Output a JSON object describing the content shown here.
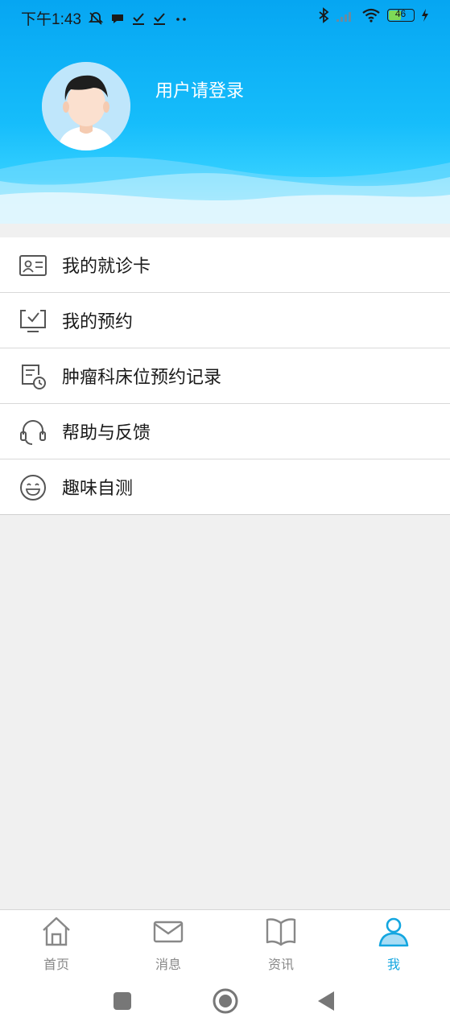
{
  "status_bar": {
    "time": "下午1:43",
    "battery": "46"
  },
  "profile": {
    "login_prompt": "用户请登录"
  },
  "menu": [
    {
      "label": "我的就诊卡",
      "icon": "id-card-icon"
    },
    {
      "label": "我的预约",
      "icon": "monitor-check-icon"
    },
    {
      "label": "肿瘤科床位预约记录",
      "icon": "document-clock-icon"
    },
    {
      "label": "帮助与反馈",
      "icon": "headset-icon"
    },
    {
      "label": "趣味自测",
      "icon": "smile-face-icon"
    }
  ],
  "tabs": [
    {
      "label": "首页",
      "icon": "home-icon"
    },
    {
      "label": "消息",
      "icon": "mail-icon"
    },
    {
      "label": "资讯",
      "icon": "book-icon"
    },
    {
      "label": "我",
      "icon": "user-icon",
      "active": true
    }
  ],
  "colors": {
    "header_blue": "#06a6f2",
    "accent": "#13a6e0",
    "background": "#f0f0f0"
  }
}
